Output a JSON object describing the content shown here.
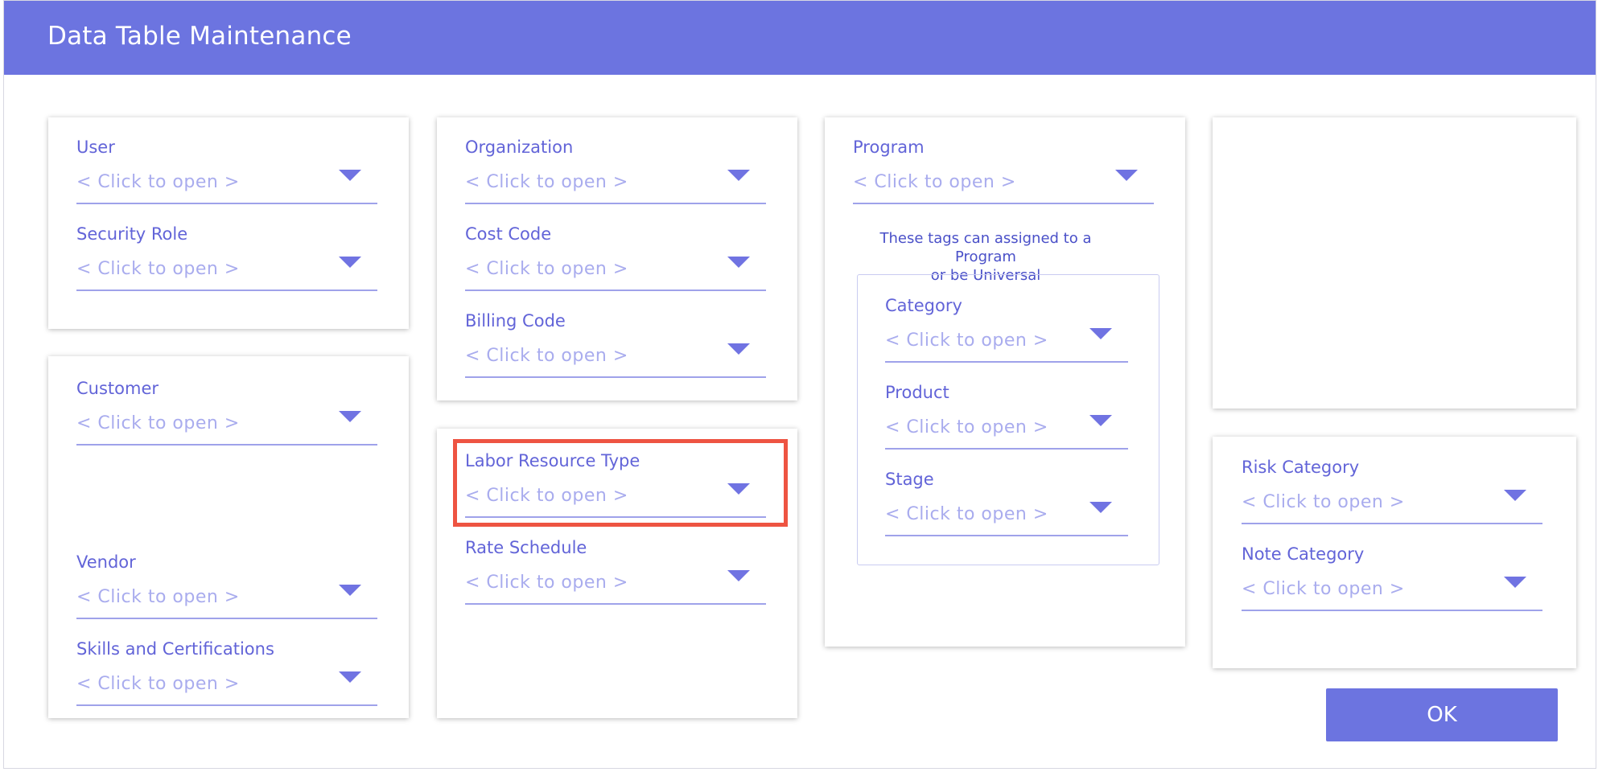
{
  "dialog": {
    "title": "Data Table Maintenance",
    "ok_label": "OK"
  },
  "fields": {
    "user": {
      "label": "User",
      "value": "< Click to open >"
    },
    "security_role": {
      "label": "Security Role",
      "value": "< Click to open >"
    },
    "customer": {
      "label": "Customer",
      "value": "< Click to open >"
    },
    "vendor": {
      "label": "Vendor",
      "value": "< Click to open >"
    },
    "skills": {
      "label": "Skills and Certifications",
      "value": "< Click to open >"
    },
    "organization": {
      "label": "Organization",
      "value": "< Click to open >"
    },
    "cost_code": {
      "label": "Cost Code",
      "value": "< Click to open >"
    },
    "billing_code": {
      "label": "Billing Code",
      "value": "< Click to open >"
    },
    "labor_resource_type": {
      "label": "Labor Resource Type",
      "value": "< Click to open >"
    },
    "rate_schedule": {
      "label": "Rate Schedule",
      "value": "< Click to open >"
    },
    "program": {
      "label": "Program",
      "value": "< Click to open >"
    },
    "category": {
      "label": "Category",
      "value": "< Click to open >"
    },
    "product": {
      "label": "Product",
      "value": "< Click to open >"
    },
    "stage": {
      "label": "Stage",
      "value": "< Click to open >"
    },
    "risk_category": {
      "label": "Risk Category",
      "value": "< Click to open >"
    },
    "note_category": {
      "label": "Note Category",
      "value": "< Click to open >"
    }
  },
  "program_panel": {
    "note_line1": "These tags can assigned to a Program",
    "note_line2": "or be Universal"
  },
  "colors": {
    "accent": "#6c74e0",
    "label": "#6264d8",
    "placeholder": "#a9acee",
    "highlight": "#ee5442"
  },
  "icons": {
    "dropdown": "chevron-down-icon"
  }
}
